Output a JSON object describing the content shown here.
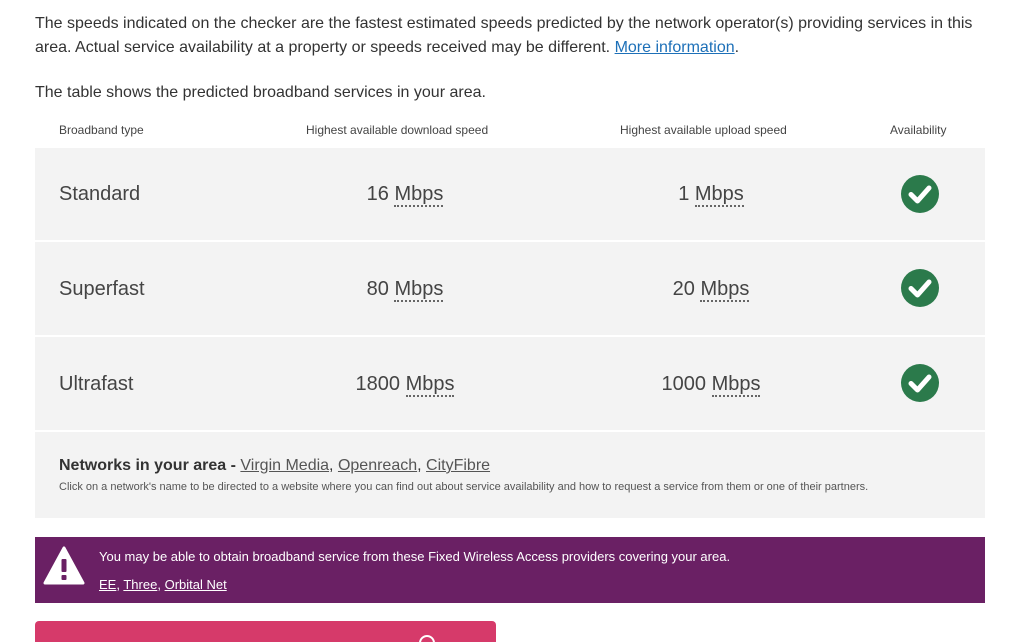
{
  "intro": {
    "text": "The speeds indicated on the checker are the fastest estimated speeds predicted by the network operator(s) providing services in this area. Actual service availability at a property or speeds received may be different.",
    "link_label": "More information"
  },
  "table": {
    "intro": "The table shows the predicted broadband services in your area.",
    "headers": {
      "type": "Broadband type",
      "download": "Highest available download speed",
      "upload": "Highest available upload speed",
      "availability": "Availability"
    },
    "rows": [
      {
        "type": "Standard",
        "download": "16",
        "upload": "1",
        "unit": "Mbps"
      },
      {
        "type": "Superfast",
        "download": "80",
        "upload": "20",
        "unit": "Mbps"
      },
      {
        "type": "Ultrafast",
        "download": "1800",
        "upload": "1000",
        "unit": "Mbps"
      }
    ]
  },
  "networks": {
    "title": "Networks in your area -",
    "links": [
      "Virgin Media",
      "Openreach",
      "CityFibre"
    ],
    "separator": ",",
    "note": "Click on a network's name to be directed to a website where you can find out about service availability and how to request a service from them or one of their partners."
  },
  "fwa": {
    "text": "You may be able to obtain broadband service from these Fixed Wireless Access providers covering your area.",
    "links": [
      "EE",
      "Three",
      "Orbital Net"
    ],
    "separator": ","
  },
  "icons": {
    "available": "check-circle-icon",
    "warning": "warning-triangle-icon"
  },
  "colors": {
    "available_green": "#2b7a4b",
    "fwa_purple": "#6a2064",
    "cta_pink": "#d63a6a",
    "link_blue": "#1d70b8"
  }
}
